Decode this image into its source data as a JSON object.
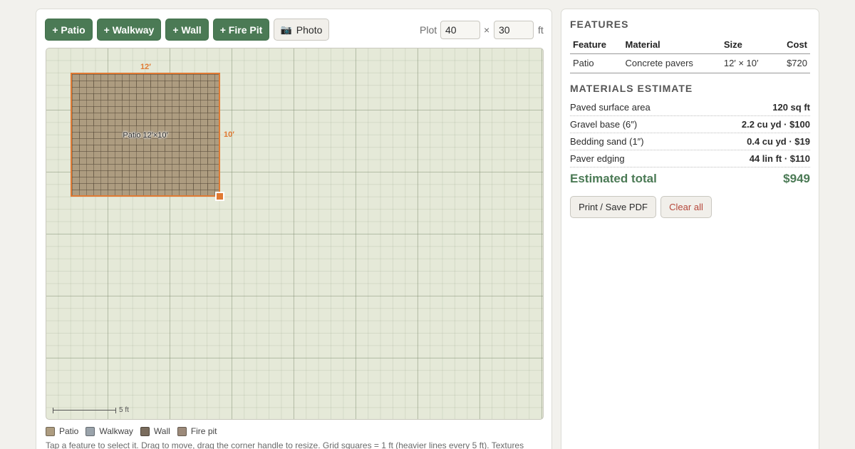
{
  "toolbar": {
    "add_patio": "+ Patio",
    "add_walkway": "+ Walkway",
    "add_wall": "+ Wall",
    "add_fire_pit": "+ Fire Pit",
    "photo": "Photo",
    "photo_icon": "camera-icon"
  },
  "plot": {
    "label": "Plot",
    "width": "40",
    "separator": "×",
    "height": "30",
    "unit": "ft"
  },
  "canvas": {
    "patio": {
      "label": "Patio 12′×10′",
      "width_label": "12′",
      "height_label": "10′"
    },
    "scale_label": "5 ft"
  },
  "legend": [
    {
      "label": "Patio",
      "color": "#ad9c80"
    },
    {
      "label": "Walkway",
      "color": "#9aa3ab"
    },
    {
      "label": "Wall",
      "color": "#7a6c5d"
    },
    {
      "label": "Fire pit",
      "color": "#9c8a7a"
    }
  ],
  "help_text": "Tap a feature to select it. Drag to move, drag the corner handle to resize. Grid squares = 1 ft (heavier lines every 5 ft). Textures",
  "features": {
    "title": "FEATURES",
    "columns": [
      "Feature",
      "Material",
      "Size",
      "Cost"
    ],
    "rows": [
      [
        "Patio",
        "Concrete pavers",
        "12′ × 10′",
        "$720"
      ]
    ]
  },
  "materials": {
    "title": "MATERIALS ESTIMATE",
    "rows": [
      {
        "label": "Paved surface area",
        "value": "120 sq ft"
      },
      {
        "label": "Gravel base (6″)",
        "value": "2.2 cu yd · $100"
      },
      {
        "label": "Bedding sand (1″)",
        "value": "0.4 cu yd · $19"
      },
      {
        "label": "Paver edging",
        "value": "44 lin ft · $110"
      }
    ],
    "total_label": "Estimated total",
    "total_value": "$949"
  },
  "actions": {
    "print": "Print / Save PDF",
    "clear": "Clear all"
  },
  "colors": {
    "accent": "#4b7a55",
    "selection": "#e07a33",
    "danger": "#b5473a"
  }
}
